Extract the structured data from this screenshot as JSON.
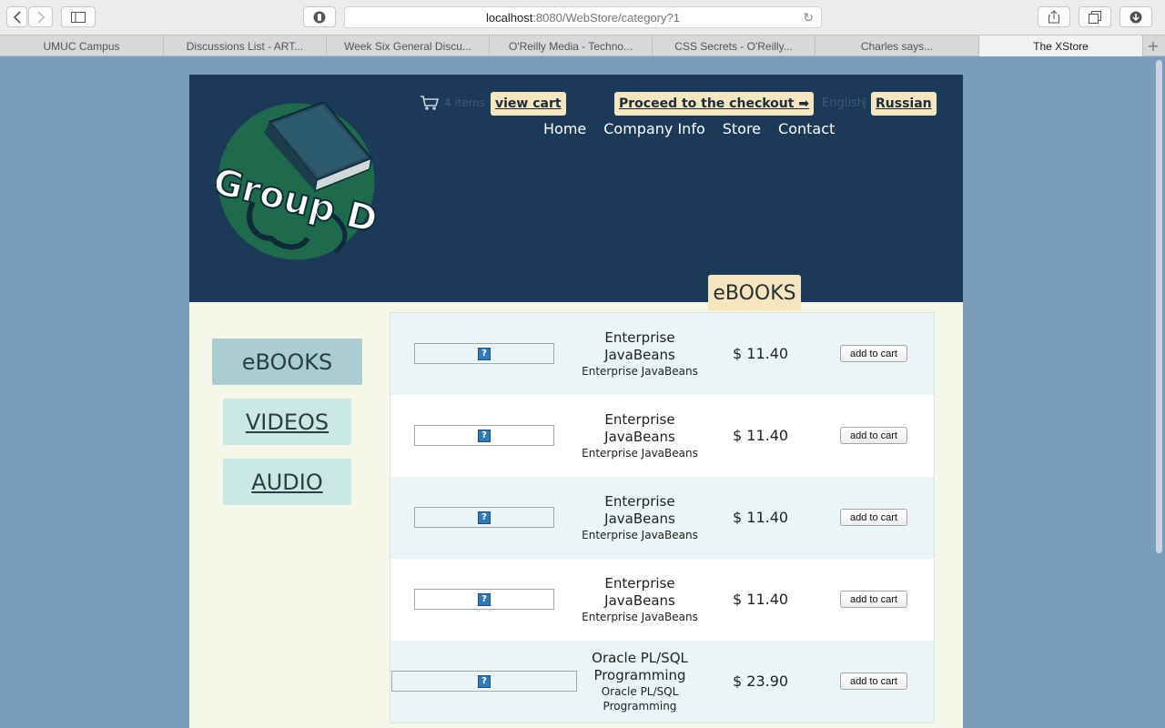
{
  "browser": {
    "url_host": "localhost",
    "url_rest": ":8080/WebStore/category?1",
    "tabs": [
      {
        "label": "UMUC Campus"
      },
      {
        "label": "Discussions List - ART..."
      },
      {
        "label": "Week Six General Discu..."
      },
      {
        "label": "O'Reilly Media - Techno..."
      },
      {
        "label": "CSS Secrets - O'Reilly..."
      },
      {
        "label": "Charles says..."
      },
      {
        "label": "The XStore"
      }
    ],
    "active_tab_index": 6
  },
  "header": {
    "logo_text": "Group D",
    "cart_count": "4 items",
    "view_cart": "view cart",
    "checkout": "Proceed to the checkout ➡",
    "lang_english": "English",
    "lang_sep": "|",
    "lang_russian": "Russian",
    "nav": [
      "Home",
      "Company Info",
      "Store",
      "Contact"
    ]
  },
  "category_tab": "eBOOKS",
  "sidebar": {
    "items": [
      "eBOOKS",
      "VIDEOS",
      "AUDIO"
    ],
    "active": "eBOOKS"
  },
  "products": [
    {
      "title": "Enterprise JavaBeans",
      "subtitle": "Enterprise JavaBeans",
      "price": "$ 11.40",
      "button": "add to cart"
    },
    {
      "title": "Enterprise JavaBeans",
      "subtitle": "Enterprise JavaBeans",
      "price": "$ 11.40",
      "button": "add to cart"
    },
    {
      "title": "Enterprise JavaBeans",
      "subtitle": "Enterprise JavaBeans",
      "price": "$ 11.40",
      "button": "add to cart"
    },
    {
      "title": "Enterprise JavaBeans",
      "subtitle": "Enterprise JavaBeans",
      "price": "$ 11.40",
      "button": "add to cart"
    },
    {
      "title": "Oracle PL/SQL Programming",
      "subtitle": "Oracle PL/SQL Programming",
      "price": "$ 23.90",
      "button": "add to cart"
    }
  ],
  "colors": {
    "header_bg": "#1b3a58",
    "page_bg": "#f7f7e9",
    "button_accent": "#f5e6c0",
    "sidebar_active": "#a9cdd0",
    "sidebar_inactive": "#cce8e3"
  }
}
